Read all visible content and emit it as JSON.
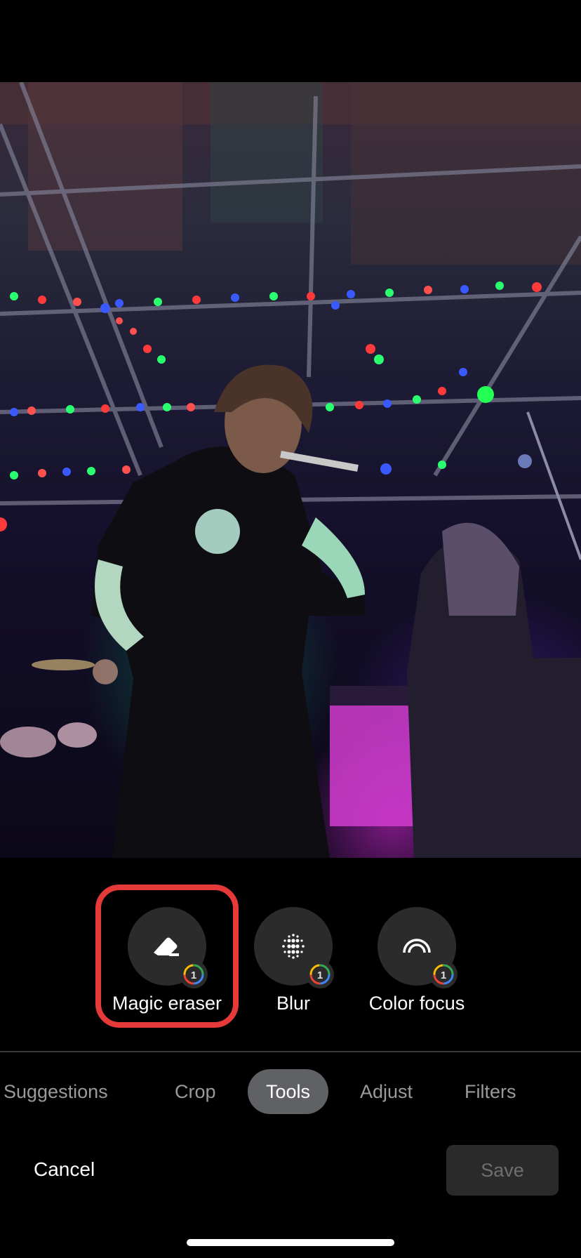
{
  "photo": {
    "description_icon": "concert-photo"
  },
  "tools": {
    "items": [
      {
        "label": "Magic eraser",
        "icon": "eraser-icon",
        "badge": "google-one-icon",
        "highlighted": true
      },
      {
        "label": "Blur",
        "icon": "blur-dots-icon",
        "badge": "google-one-icon",
        "highlighted": false
      },
      {
        "label": "Color focus",
        "icon": "arc-icon",
        "badge": "google-one-icon",
        "highlighted": false
      }
    ],
    "highlight_color": "#e63a3a"
  },
  "tabs": {
    "items": [
      "Suggestions",
      "Crop",
      "Tools",
      "Adjust",
      "Filters"
    ],
    "active": "Tools"
  },
  "footer": {
    "cancel_label": "Cancel",
    "save_label": "Save"
  },
  "colors": {
    "background": "#000000",
    "active_tab": "#5f6164",
    "tool_circle": "#2b2b2b"
  }
}
